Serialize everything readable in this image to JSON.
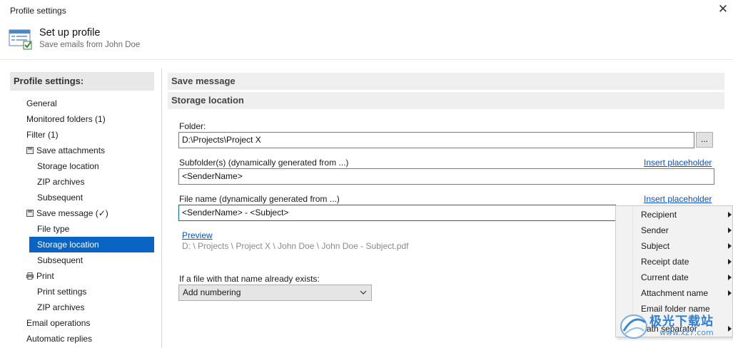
{
  "window": {
    "title": "Profile settings"
  },
  "header": {
    "title": "Set up profile",
    "subtitle": "Save emails from John Doe"
  },
  "sidebar": {
    "heading": "Profile settings:",
    "items": [
      {
        "label": "General",
        "level": 0
      },
      {
        "label": "Monitored folders (1)",
        "level": 0
      },
      {
        "label": "Filter (1)",
        "level": 0
      },
      {
        "label": "Save attachments",
        "level": 0,
        "icon": "save-icon"
      },
      {
        "label": "Storage location",
        "level": 1
      },
      {
        "label": "ZIP archives",
        "level": 1
      },
      {
        "label": "Subsequent",
        "level": 1
      },
      {
        "label": "Save message (✓)",
        "level": 0,
        "icon": "save-icon"
      },
      {
        "label": "File type",
        "level": 1
      },
      {
        "label": "Storage location",
        "level": 1,
        "selected": true
      },
      {
        "label": "Subsequent",
        "level": 1
      },
      {
        "label": "Print",
        "level": 0,
        "icon": "printer-icon"
      },
      {
        "label": "Print settings",
        "level": 1
      },
      {
        "label": "ZIP archives",
        "level": 1
      },
      {
        "label": "Email operations",
        "level": 0
      },
      {
        "label": "Automatic replies",
        "level": 0
      }
    ]
  },
  "main": {
    "section_title": "Save message",
    "subsection_title": "Storage location",
    "folder": {
      "label": "Folder:",
      "value": "D:\\Projects\\Project X",
      "browse_label": "..."
    },
    "subfolders": {
      "label": "Subfolder(s) (dynamically generated from ...)",
      "value": "<SenderName>",
      "link": "Insert placeholder"
    },
    "filename": {
      "label": "File name (dynamically generated from ...)",
      "value": "<SenderName> - <Subject>",
      "link": "Insert placeholder"
    },
    "preview": {
      "link": "Preview",
      "path": "D: \\ Projects \\ Project X \\ John Doe \\ John Doe - Subject.pdf"
    },
    "exists": {
      "label": "If a file with that name already exists:",
      "selected": "Add numbering"
    }
  },
  "context_menu": {
    "items": [
      {
        "label": "Recipient",
        "submenu": true
      },
      {
        "label": "Sender",
        "submenu": true
      },
      {
        "label": "Subject",
        "submenu": true
      },
      {
        "label": "Receipt date",
        "submenu": true
      },
      {
        "label": "Current date",
        "submenu": true
      },
      {
        "label": "Attachment name",
        "submenu": true
      },
      {
        "label": "Email folder name",
        "submenu": false
      },
      {
        "label": "Path separator",
        "submenu": true
      }
    ]
  },
  "watermark": {
    "text": "极光下载站",
    "url": "www.xz7.com"
  },
  "colors": {
    "accent": "#0a64c4",
    "link": "#0a4fcf",
    "section_bg": "#efefef",
    "sidebar_head_bg": "#e8e8e8"
  }
}
